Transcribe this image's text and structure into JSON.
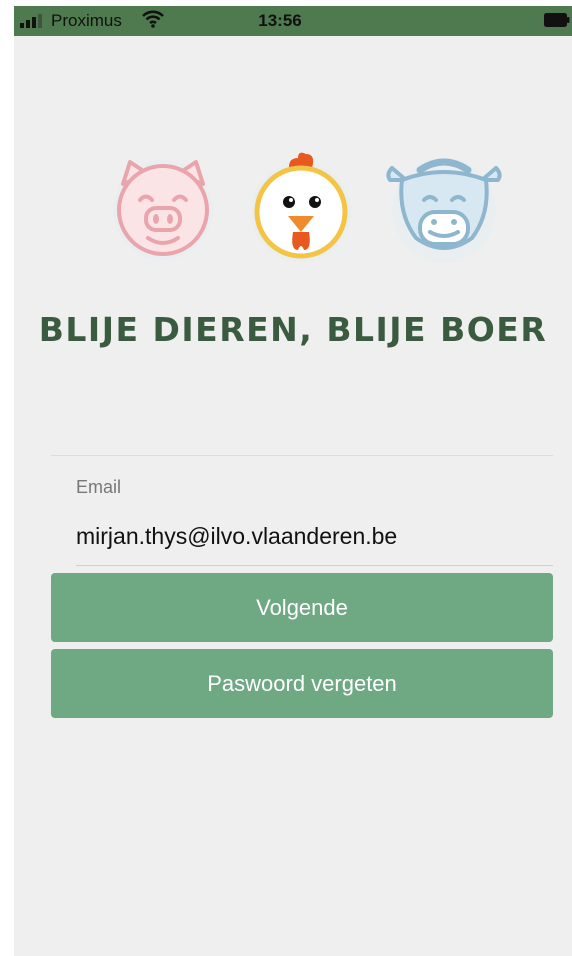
{
  "status_bar": {
    "carrier": "Proximus",
    "time": "13:56",
    "background": "#4f7a4f"
  },
  "logo": {
    "animals": [
      "pig-icon",
      "chicken-icon",
      "cow-icon"
    ]
  },
  "app_title": "BLIJE DIEREN, BLIJE BOER",
  "login": {
    "email_label": "Email",
    "email_value": "mirjan.thys@ilvo.vlaanderen.be",
    "next_label": "Volgende",
    "forgot_label": "Paswoord vergeten"
  },
  "colors": {
    "title": "#3b5b41",
    "button": "#6ea983",
    "background": "#efefef"
  }
}
